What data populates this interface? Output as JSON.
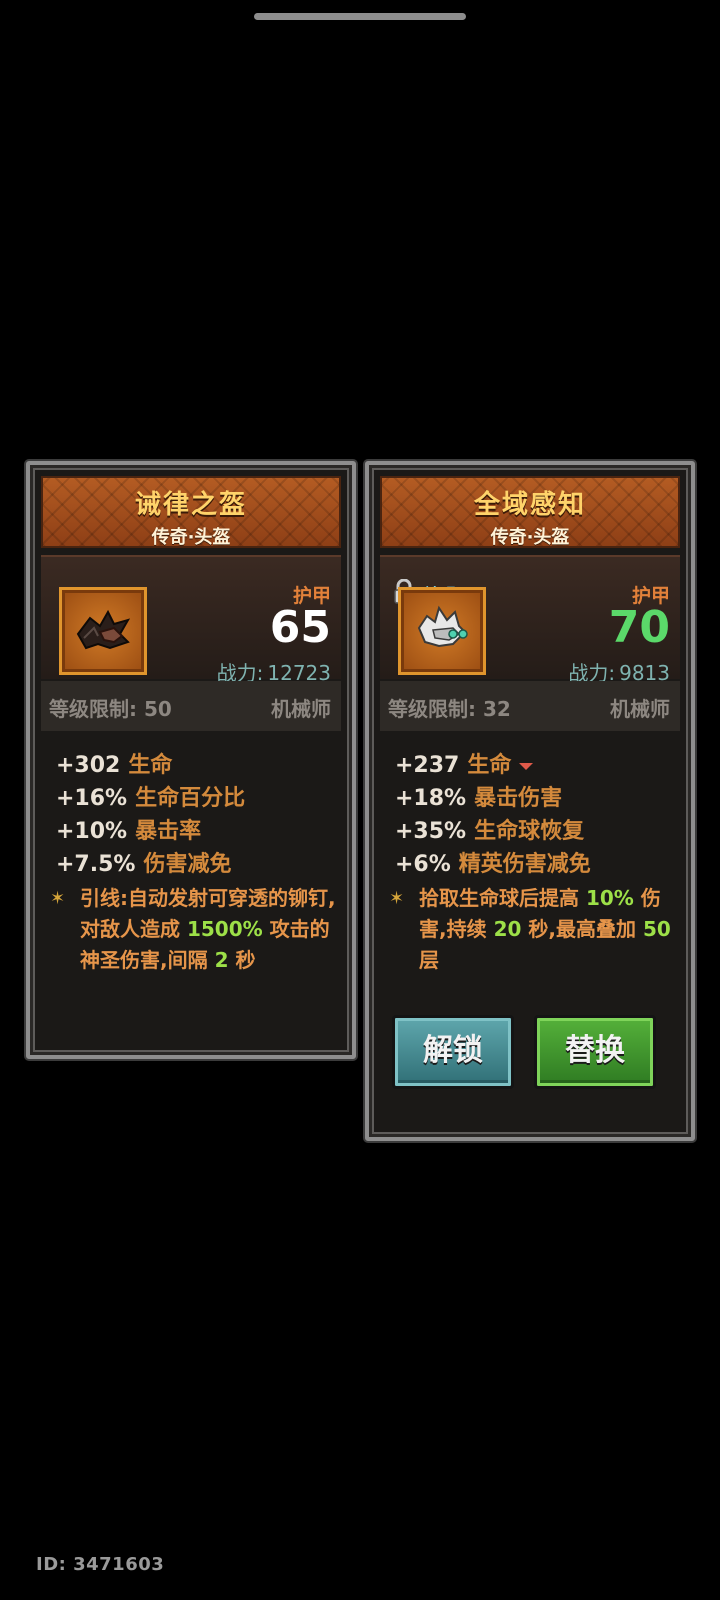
{
  "cards": [
    {
      "name": "诫律之盔",
      "type": "传奇·头盔",
      "armor_label": "护甲",
      "armor_value": "65",
      "power_label": "战力:",
      "power_value": "12723",
      "level_req": "等级限制: 50",
      "class": "机械师",
      "stats": [
        {
          "value": "+302",
          "name": "生命"
        },
        {
          "value": "+16%",
          "name": "生命百分比"
        },
        {
          "value": "+10%",
          "name": "暴击率"
        },
        {
          "value": "+7.5%",
          "name": "伤害减免"
        }
      ],
      "passive": {
        "p1": "引线:自动发射可穿透的铆钉,对敌人造成 ",
        "v1": "1500%",
        "p2": " 攻击的神圣伤害,间隔 ",
        "v2": "2",
        "p3": " 秒"
      }
    },
    {
      "name": "全域感知",
      "type": "传奇·头盔",
      "badge": "神赐",
      "armor_label": "护甲",
      "armor_value": "70",
      "power_label": "战力:",
      "power_value": "9813",
      "level_req": "等级限制: 32",
      "class": "机械师",
      "stats": [
        {
          "value": "+237",
          "name": "生命"
        },
        {
          "value": "+18%",
          "name": "暴击伤害"
        },
        {
          "value": "+35%",
          "name": "生命球恢复"
        },
        {
          "value": "+6%",
          "name": "精英伤害减免"
        }
      ],
      "passive": {
        "p1": "拾取生命球后提高 ",
        "v1": "10%",
        "p2": " 伤害,持续 ",
        "v2": "20",
        "p3": " 秒,最高叠加 ",
        "v3": "50",
        "p4": " 层"
      },
      "buttons": {
        "unlock": "解锁",
        "replace": "替换"
      }
    }
  ],
  "footer_id": "ID: 3471603",
  "colors": {
    "armor_current": "#ffffff",
    "armor_new": "#5bd96a",
    "highlight": "#9de048"
  }
}
